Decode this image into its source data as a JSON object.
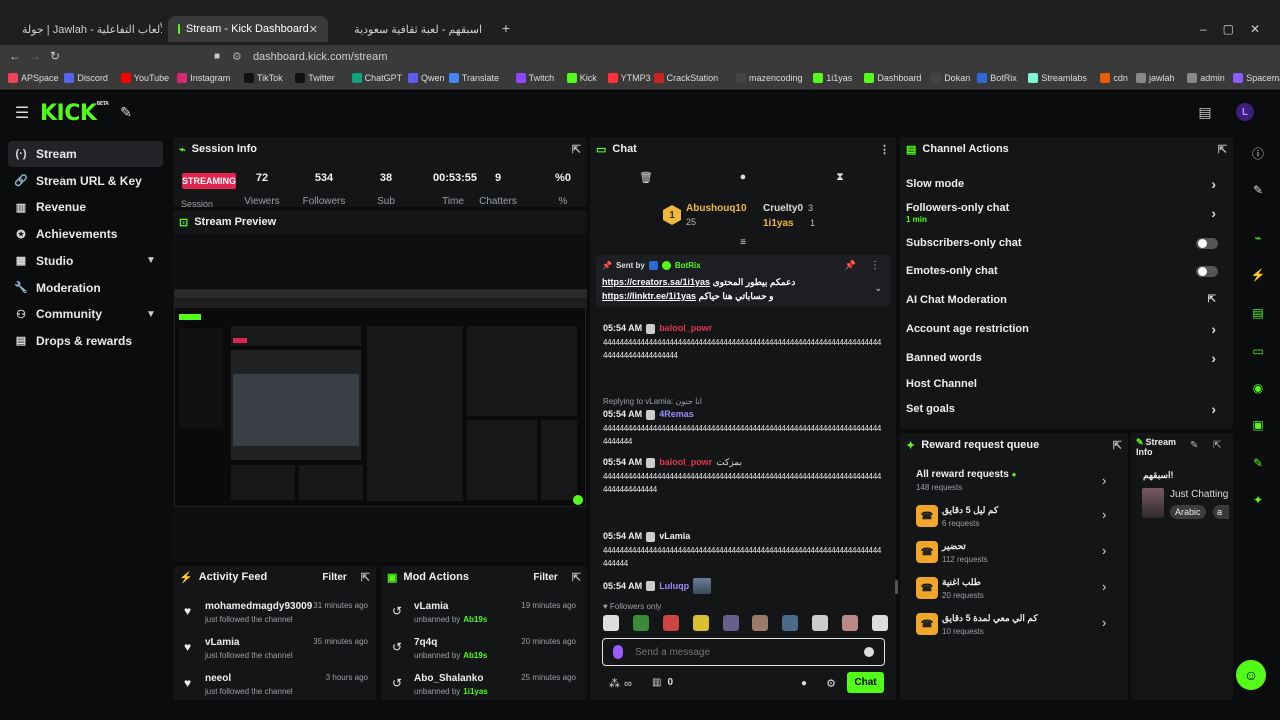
{
  "browser": {
    "tabs": [
      {
        "label": "جولة | Jawlah - منصة الألعاب التفاعلية",
        "active": false
      },
      {
        "label": "Stream - Kick Dashboard",
        "active": true
      },
      {
        "label": "اسبقهم - لعبة ثقافية سعودية",
        "active": false
      }
    ],
    "url": "dashboard.kick.com/stream",
    "bookmarks": [
      "APSpace",
      "Discord",
      "YouTube",
      "Instagram",
      "TikTok",
      "Twitter",
      "ChatGPT",
      "Qwen",
      "Translate",
      "Twitch",
      "Kick",
      "YTMP3",
      "CrackStation",
      "mazencoding",
      "1i1yas",
      "Dashboard",
      "Dokan",
      "BotRix",
      "Streamlabs",
      "cdn",
      "jawlah",
      "admin",
      "Spacemail"
    ]
  },
  "sidebar": {
    "logo": "KICK",
    "logo_sup": "BETA",
    "items": [
      {
        "label": "Stream",
        "icon": "stream-icon"
      },
      {
        "label": "Stream URL & Key",
        "icon": "link-icon"
      },
      {
        "label": "Revenue",
        "icon": "revenue-icon"
      },
      {
        "label": "Achievements",
        "icon": "trophy-icon"
      },
      {
        "label": "Studio",
        "icon": "studio-icon"
      },
      {
        "label": "Moderation",
        "icon": "wrench-icon"
      },
      {
        "label": "Community",
        "icon": "community-icon"
      },
      {
        "label": "Drops & rewards",
        "icon": "gift-icon"
      }
    ]
  },
  "session": {
    "title": "Session Info",
    "status": "STREAMING",
    "status_sub": "Session",
    "stats": [
      {
        "value": "72",
        "label": "Viewers"
      },
      {
        "value": "534",
        "label": "Followers"
      },
      {
        "value": "38",
        "label": "Sub"
      },
      {
        "value": "00:53:55",
        "label": "Time"
      },
      {
        "value": "9",
        "label": "Chatters"
      },
      {
        "value": "%0",
        "label": "%"
      }
    ]
  },
  "preview": {
    "title": "Stream Preview"
  },
  "activity": {
    "title": "Activity Feed",
    "filter": "Filter",
    "items": [
      {
        "name": "mohamedmagdy93009",
        "time": "31 minutes ago",
        "desc": "just followed the channel"
      },
      {
        "name": "vLamia",
        "time": "35 minutes ago",
        "desc": "just followed the channel"
      },
      {
        "name": "neeol",
        "time": "3 hours ago",
        "desc": "just followed the channel"
      }
    ]
  },
  "modactions": {
    "title": "Mod Actions",
    "filter": "Filter",
    "items": [
      {
        "name": "vLamia",
        "time": "19 minutes ago",
        "desc": "unbanned by",
        "by": "Ab19s"
      },
      {
        "name": "7q4q",
        "time": "20 minutes ago",
        "desc": "unbanned by",
        "by": "Ab19s"
      },
      {
        "name": "Abo_Shalanko",
        "time": "25 minutes ago",
        "desc": "unbanned by",
        "by": "1i1yas"
      }
    ]
  },
  "chat": {
    "title": "Chat",
    "leaders": [
      {
        "rank": "1",
        "name": "Abushouq10",
        "count": "25"
      },
      {
        "name": "Cruelty0",
        "count": "3"
      },
      {
        "name": "1i1yas",
        "count": "1"
      }
    ],
    "pinned": {
      "label": "Sent by",
      "sender": "BotRix",
      "line1_link": "https://creators.sa/1i1yas",
      "line1_text": "دعمكم بيطور المحتوى",
      "line2_link": "https://linktr.ee/1i1yas",
      "line2_text": "و حساباتي هنا حياكم"
    },
    "messages": [
      {
        "time": "05:54 AM",
        "user": "balool_powr",
        "color": "#e0344f",
        "text": "4444444444444444444444444444444444444444444444444444444444444444444444444444444444444"
      },
      {
        "reply": "Replying to vLamia: انا حنون",
        "time": "05:54 AM",
        "user": "4Remas",
        "color": "#9b8cff",
        "text": "44444444444444444444444444444444444444444444444444444444444444444444444444"
      },
      {
        "time": "05:54 AM",
        "user": "balool_powr",
        "color": "#e0344f",
        "extra": "بمزكت",
        "text": "44444444444444444444444444444444444444444444444444444444444444444444444444444444"
      },
      {
        "time": "05:54 AM",
        "user": "vLamia",
        "color": "#eeeeee",
        "text": "4444444444444444444444444444444444444444444444444444444444444444444444444"
      },
      {
        "time": "05:54 AM",
        "user": "Luluqp",
        "color": "#9b8cff",
        "text": ""
      }
    ],
    "followers_only": "Followers only",
    "input_placeholder": "Send a message",
    "infinity": "∞",
    "count": "0",
    "send_label": "Chat"
  },
  "channel_actions": {
    "title": "Channel Actions",
    "rows": [
      {
        "label": "Slow mode",
        "type": "chevron"
      },
      {
        "label": "Followers-only chat",
        "sub": "1 min",
        "type": "chevron"
      },
      {
        "label": "Subscribers-only chat",
        "type": "toggle"
      },
      {
        "label": "Emotes-only chat",
        "type": "toggle"
      },
      {
        "label": "AI Chat Moderation",
        "type": "external"
      },
      {
        "label": "Account age restriction",
        "type": "chevron"
      },
      {
        "label": "Banned words",
        "type": "chevron"
      },
      {
        "label": "Host Channel",
        "type": "none"
      },
      {
        "label": "Set goals",
        "type": "chevron"
      }
    ]
  },
  "rewards": {
    "title": "Reward request queue",
    "all_label": "All reward requests",
    "all_count": "148 requests",
    "items": [
      {
        "name": "كم ليل 5 دقايق",
        "count": "6 requests"
      },
      {
        "name": "تحضير",
        "count": "112 requests"
      },
      {
        "name": "طلب اغنية",
        "count": "20 requests"
      },
      {
        "name": "كم الي معي لمدة 5 دقايق",
        "count": "10 requests"
      }
    ]
  },
  "stream_info": {
    "title": "Stream Info",
    "stream_title": "اسبقهم!",
    "category": "Just Chatting",
    "tags": [
      "Arabic",
      "a"
    ]
  },
  "colors": {
    "accent": "#53fc18",
    "live": "#e0244d",
    "panel": "#141517",
    "bg": "#0b0c0d"
  }
}
